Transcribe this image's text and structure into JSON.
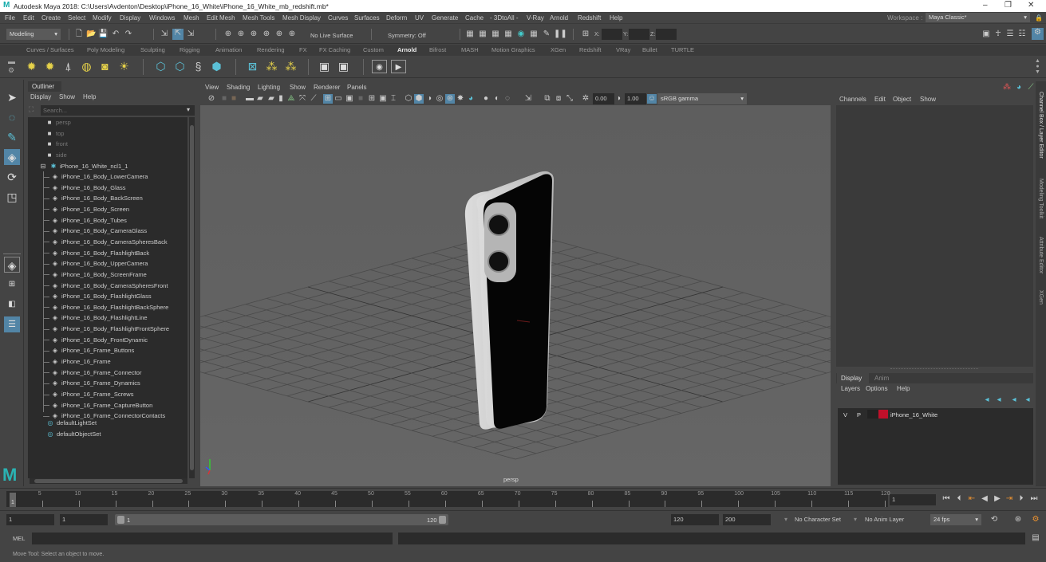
{
  "window": {
    "title": "Autodesk Maya 2018: C:\\Users\\Avdenton\\Desktop\\iPhone_16_White\\iPhone_16_White_mb_redshift.mb*",
    "logo_icon": "maya-logo-icon",
    "controls": {
      "minimize": "–",
      "restore": "❐",
      "close": "✕"
    }
  },
  "menubar": {
    "items": [
      "File",
      "Edit",
      "Create",
      "Select",
      "Modify",
      "Display",
      "Windows",
      "Mesh",
      "Edit Mesh",
      "Mesh Tools",
      "Mesh Display",
      "Curves",
      "Surfaces",
      "Deform",
      "UV",
      "Generate",
      "Cache",
      "- 3DtoAll -",
      "V-Ray",
      "Arnold",
      "Redshift",
      "Help"
    ],
    "workspace_label": "Workspace :",
    "workspace_value": "Maya Classic*"
  },
  "statusline": {
    "mode": "Modeling",
    "live_surface": "No Live Surface",
    "symmetry": "Symmetry: Off",
    "x_label": "X:",
    "y_label": "Y:",
    "z_label": "Z:",
    "x_value": "",
    "y_value": "",
    "z_value": ""
  },
  "shelf": {
    "tabs": [
      "Curves / Surfaces",
      "Poly Modeling",
      "Sculpting",
      "Rigging",
      "Animation",
      "Rendering",
      "FX",
      "FX Caching",
      "Custom",
      "Arnold",
      "Bifrost",
      "MASH",
      "Motion Graphics",
      "XGen",
      "Redshift",
      "VRay",
      "Bullet",
      "TURTLE"
    ],
    "active_tab": "Arnold"
  },
  "outliner": {
    "tab": "Outliner",
    "menu": [
      "Display",
      "Show",
      "Help"
    ],
    "search_placeholder": "Search...",
    "cameras": [
      "persp",
      "top",
      "front",
      "side"
    ],
    "group": "iPhone_16_White_ncl1_1",
    "children": [
      "iPhone_16_Body_LowerCamera",
      "iPhone_16_Body_Glass",
      "iPhone_16_Body_BackScreen",
      "iPhone_16_Body_Screen",
      "iPhone_16_Body_Tubes",
      "iPhone_16_Body_CameraGlass",
      "iPhone_16_Body_CameraSpheresBack",
      "iPhone_16_Body_FlashlightBack",
      "iPhone_16_Body_UpperCamera",
      "iPhone_16_Body_ScreenFrame",
      "iPhone_16_Body_CameraSpheresFront",
      "iPhone_16_Body_FlashlightGlass",
      "iPhone_16_Body_FlashlightBackSphere",
      "iPhone_16_Body_FlashlightLine",
      "iPhone_16_Body_FlashlightFrontSphere",
      "iPhone_16_Body_FrontDynamic",
      "iPhone_16_Frame_Buttons",
      "iPhone_16_Frame",
      "iPhone_16_Frame_Connector",
      "iPhone_16_Frame_Dynamics",
      "iPhone_16_Frame_Screws",
      "iPhone_16_Frame_CaptureButton",
      "iPhone_16_Frame_ConnectorContacts"
    ],
    "sets": [
      "defaultLightSet",
      "defaultObjectSet"
    ]
  },
  "viewport": {
    "menu": [
      "View",
      "Shading",
      "Lighting",
      "Show",
      "Renderer",
      "Panels"
    ],
    "exposure": "0.00",
    "gamma": "1.00",
    "color_space": "sRGB gamma",
    "camera_label": "persp"
  },
  "channelbox": {
    "menu": [
      "Channels",
      "Edit",
      "Object",
      "Show"
    ]
  },
  "layer_editor": {
    "tabs": [
      "Display",
      "Anim"
    ],
    "active_tab": "Display",
    "menu": [
      "Layers",
      "Options",
      "Help"
    ],
    "layers": [
      {
        "v": "V",
        "p": "P",
        "color": "#c0102a",
        "name": "iPhone_16_White"
      }
    ]
  },
  "side_tabs": [
    "Channel Box / Layer Editor",
    "Modeling Toolkit",
    "Attribute Editor",
    "XGen"
  ],
  "timeline": {
    "ticks": [
      1,
      5,
      10,
      15,
      20,
      25,
      30,
      35,
      40,
      45,
      50,
      55,
      60,
      65,
      70,
      75,
      80,
      85,
      90,
      95,
      100,
      105,
      110,
      115,
      120
    ],
    "range_start": 1,
    "range_end": 120,
    "current_frame": "1"
  },
  "range": {
    "anim_start": "1",
    "playback_start": "1",
    "slider_start": "1",
    "slider_end": "120",
    "playback_end": "120",
    "anim_end": "200",
    "character_set": "No Character Set",
    "anim_layer": "No Anim Layer",
    "fps": "24 fps"
  },
  "cmdline": {
    "label": "MEL",
    "value": "",
    "result": ""
  },
  "helpline": {
    "text": "Move Tool: Select an object to move."
  }
}
